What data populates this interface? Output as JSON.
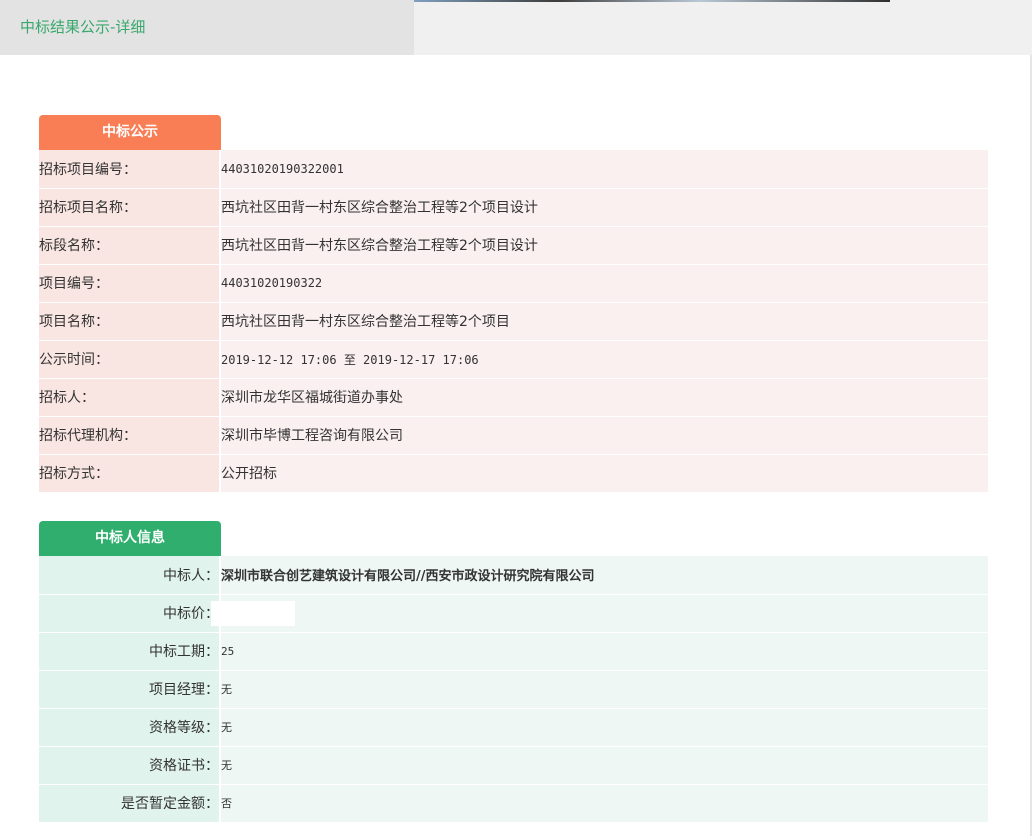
{
  "page": {
    "title": "中标结果公示-详细"
  },
  "award_section": {
    "header": "中标公示",
    "rows": [
      {
        "label": "招标项目编号：",
        "value": "44031020190322001"
      },
      {
        "label": "招标项目名称：",
        "value": "西坑社区田背一村东区综合整治工程等2个项目设计"
      },
      {
        "label": "标段名称：",
        "value": "西坑社区田背一村东区综合整治工程等2个项目设计"
      },
      {
        "label": "项目编号：",
        "value": "44031020190322"
      },
      {
        "label": "项目名称：",
        "value": "西坑社区田背一村东区综合整治工程等2个项目"
      },
      {
        "label": "公示时间：",
        "value": "2019-12-12 17:06 至 2019-12-17 17:06"
      },
      {
        "label": "招标人：",
        "value": "深圳市龙华区福城街道办事处"
      },
      {
        "label": "招标代理机构：",
        "value": "深圳市毕博工程咨询有限公司"
      },
      {
        "label": "招标方式：",
        "value": "公开招标"
      }
    ]
  },
  "winner_section": {
    "header": "中标人信息",
    "rows": [
      {
        "label": "中标人：",
        "value": "深圳市联合创艺建筑设计有限公司//西安市政设计研究院有限公司"
      },
      {
        "label": "中标价：",
        "value": ""
      },
      {
        "label": "中标工期：",
        "value": "25"
      },
      {
        "label": "项目经理：",
        "value": "无"
      },
      {
        "label": "资格等级：",
        "value": "无"
      },
      {
        "label": "资格证书：",
        "value": "无"
      },
      {
        "label": "是否暂定金额：",
        "value": "否"
      }
    ]
  }
}
